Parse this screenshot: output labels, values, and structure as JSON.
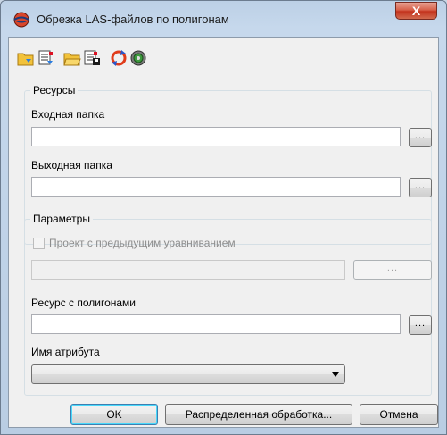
{
  "window": {
    "title": "Обрезка LAS-файлов по полигонам",
    "title_icon": "las-globe-icon",
    "close_label": "X"
  },
  "toolbar": {
    "icons": [
      "open-settings-icon",
      "save-settings-icon",
      "open-folder-icon",
      "save-as-icon",
      "refresh-icon",
      "run-icon"
    ]
  },
  "resources": {
    "legend": "Ресурсы",
    "input_folder_label": "Входная папка",
    "input_folder_value": "",
    "output_folder_label": "Выходная папка",
    "output_folder_value": "",
    "browse_label": "..."
  },
  "params": {
    "legend": "Параметры",
    "project_checkbox_label": "Проект с предыдущим уравниванием",
    "project_checked": false,
    "project_value": "",
    "polygon_resource_label": "Ресурс с полигонами",
    "polygon_resource_value": "",
    "attribute_label": "Имя атрибута",
    "attribute_value": ""
  },
  "buttons": {
    "ok": "OK",
    "distributed": "Распределенная обработка...",
    "cancel": "Отмена"
  }
}
